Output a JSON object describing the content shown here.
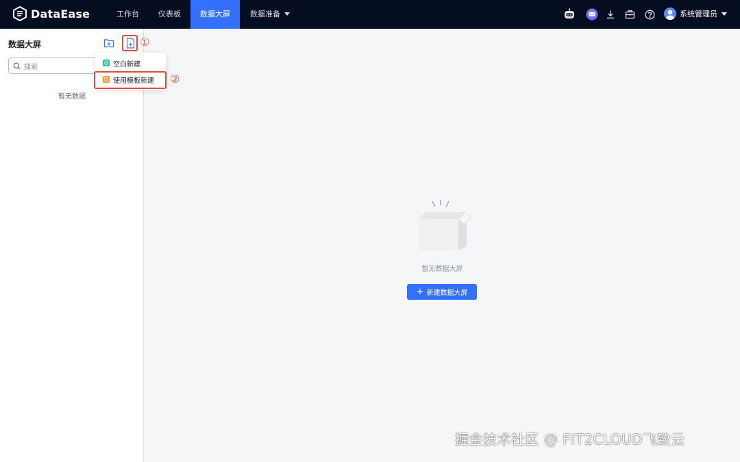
{
  "app": {
    "name": "DataEase"
  },
  "nav": {
    "items": [
      {
        "label": "工作台"
      },
      {
        "label": "仪表板"
      },
      {
        "label": "数据大屏"
      },
      {
        "label": "数据准备"
      }
    ],
    "active_index": 2
  },
  "header": {
    "user_name": "系统管理员"
  },
  "sidebar": {
    "title": "数据大屏",
    "search_placeholder": "搜索",
    "empty_text": "暂无数据"
  },
  "dropdown": {
    "items": [
      {
        "label": "空白新建"
      },
      {
        "label": "使用模板新建"
      }
    ]
  },
  "annotations": {
    "step1": "①",
    "step2": "②"
  },
  "main": {
    "empty_text": "暂无数据大屏",
    "create_button_label": "新建数据大屏"
  },
  "watermark": "掘金技术社区 @ FIT2CLOUD飞致云",
  "colors": {
    "topbar": "#050e21",
    "accent": "#3370ff",
    "annotation": "#e14a3a"
  }
}
